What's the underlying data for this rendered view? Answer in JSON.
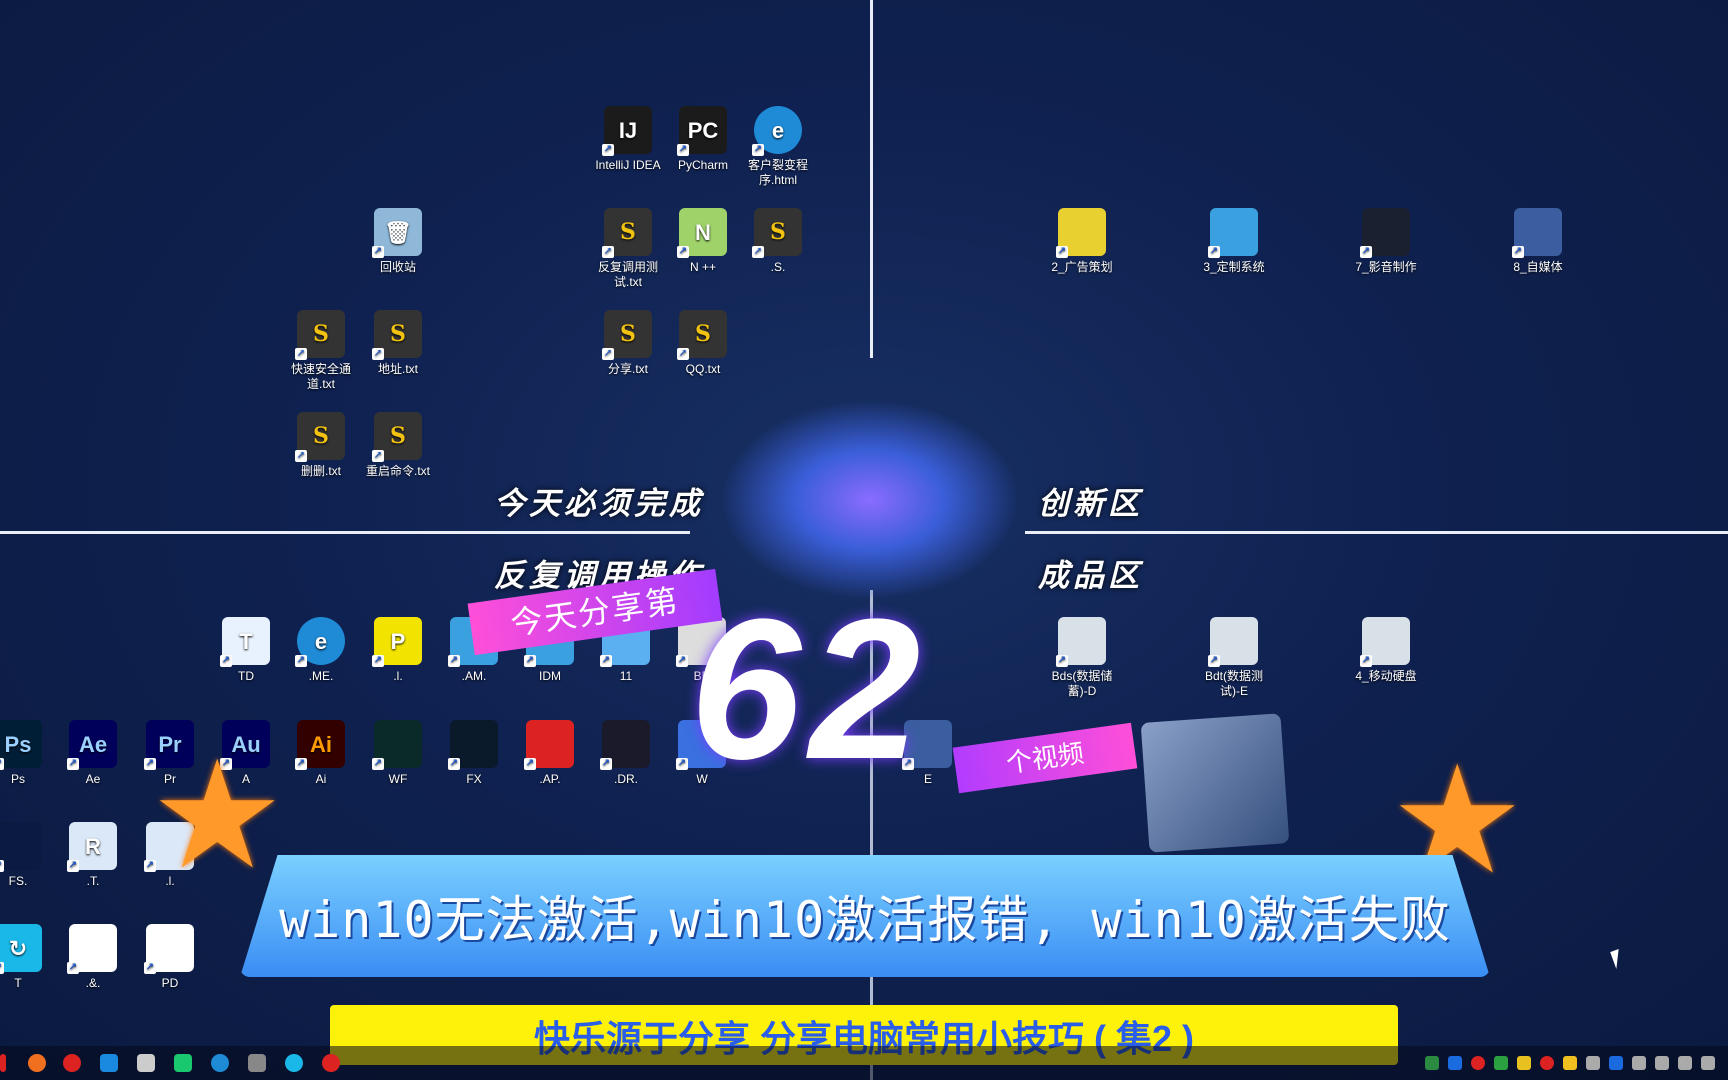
{
  "top_icons": [
    {
      "label": "IntelliJ IDEA",
      "glyph": "IJ",
      "icon": "intellij-icon",
      "color": "#1b1b1b"
    },
    {
      "label": "PyCharm",
      "glyph": "PC",
      "icon": "pycharm-icon",
      "color": "#1b1b1b"
    },
    {
      "label": "客户裂变程序.html",
      "glyph": "e",
      "icon": "edge-icon",
      "color": "#1f8ad6"
    },
    {
      "label": "回收站",
      "glyph": "🗑",
      "icon": "recycle-bin-icon",
      "color": "#8fb8d8"
    },
    {
      "label": "反复调用测试.txt",
      "glyph": "S",
      "icon": "sublime-text-icon",
      "color": "#333"
    },
    {
      "label": "N ++",
      "glyph": "N",
      "icon": "notepad-plus-icon",
      "color": "#9fd36a"
    },
    {
      "label": ".S.",
      "glyph": "S",
      "icon": "sublime-text-icon",
      "color": "#333"
    },
    {
      "label": "快速安全通道.txt",
      "glyph": "S",
      "icon": "sublime-text-icon",
      "color": "#333"
    },
    {
      "label": "地址.txt",
      "glyph": "S",
      "icon": "sublime-text-icon",
      "color": "#333"
    },
    {
      "label": "分享.txt",
      "glyph": "S",
      "icon": "sublime-text-icon",
      "color": "#333"
    },
    {
      "label": "QQ.txt",
      "glyph": "S",
      "icon": "sublime-text-icon",
      "color": "#333"
    },
    {
      "label": "删删.txt",
      "glyph": "S",
      "icon": "sublime-text-icon",
      "color": "#333"
    },
    {
      "label": "重启命令.txt",
      "glyph": "S",
      "icon": "sublime-text-icon",
      "color": "#333"
    },
    {
      "label": "2_广告策划",
      "glyph": "",
      "icon": "folder-shortcut-icon",
      "color": "#e8d030"
    },
    {
      "label": "3_定制系统",
      "glyph": "",
      "icon": "folder-shortcut-icon",
      "color": "#3aa0e0"
    },
    {
      "label": "7_影音制作",
      "glyph": "",
      "icon": "film-folder-icon",
      "color": "#1a2030"
    },
    {
      "label": "8_自媒体",
      "glyph": "",
      "icon": "film-folder-icon",
      "color": "#3a5ea0"
    }
  ],
  "bottom_icons": [
    {
      "label": "TD",
      "glyph": "T",
      "icon": "todesk-icon",
      "color": "#e8f2ff"
    },
    {
      "label": ".ME.",
      "glyph": "e",
      "icon": "edge-icon",
      "color": "#1f8ad6"
    },
    {
      "label": ".l.",
      "glyph": "P",
      "icon": "app-icon",
      "color": "#f2e400"
    },
    {
      "label": ".AM.",
      "glyph": "",
      "icon": "app-icon",
      "color": "#3aa0e0"
    },
    {
      "label": "IDM",
      "glyph": "",
      "icon": "idm-icon",
      "color": "#3aa0e0"
    },
    {
      "label": "11",
      "glyph": "",
      "icon": "app-icon",
      "color": "#5ab0f0"
    },
    {
      "label": "BD",
      "glyph": "",
      "icon": "app-icon",
      "color": "#ddd"
    },
    {
      "label": "Bds(数据储蓄)-D",
      "glyph": "",
      "icon": "drive-icon",
      "color": "#d8e0e8"
    },
    {
      "label": "Bdt(数据测试)-E",
      "glyph": "",
      "icon": "drive-icon",
      "color": "#d8e0e8"
    },
    {
      "label": "4_移动硬盘",
      "glyph": "",
      "icon": "drive-icon",
      "color": "#d8e0e8"
    },
    {
      "label": "Ps",
      "glyph": "Ps",
      "icon": "photoshop-icon",
      "color": "#001e36"
    },
    {
      "label": "Ae",
      "glyph": "Ae",
      "icon": "after-effects-icon",
      "color": "#00005b"
    },
    {
      "label": "Pr",
      "glyph": "Pr",
      "icon": "premiere-icon",
      "color": "#00005b"
    },
    {
      "label": "A",
      "glyph": "Au",
      "icon": "audition-icon",
      "color": "#00005b"
    },
    {
      "label": "Ai",
      "glyph": "Ai",
      "icon": "illustrator-icon",
      "color": "#330000"
    },
    {
      "label": "WF",
      "glyph": "",
      "icon": "filmora-icon",
      "color": "#0a2a2a"
    },
    {
      "label": "FX",
      "glyph": "",
      "icon": "filmora-icon",
      "color": "#0a1a2a"
    },
    {
      "label": ".AP.",
      "glyph": "",
      "icon": "app-icon",
      "color": "#d22"
    },
    {
      "label": ".DR.",
      "glyph": "",
      "icon": "davinci-icon",
      "color": "#1a1a2a"
    },
    {
      "label": "W",
      "glyph": "",
      "icon": "app-icon",
      "color": "#3a70e0"
    },
    {
      "label": "E",
      "glyph": "",
      "icon": "app-icon",
      "color": "#3a5ea0"
    },
    {
      "label": "FS.",
      "glyph": "",
      "icon": "audio-bars-icon",
      "color": "#0a1a40"
    },
    {
      "label": ".T.",
      "glyph": "R",
      "icon": "app-icon",
      "color": "#dbe8f8"
    },
    {
      "label": ".l.",
      "glyph": "",
      "icon": "app-icon",
      "color": "#dbe8f8"
    },
    {
      "label": "T",
      "glyph": "↻",
      "icon": "sync-icon",
      "color": "#1ab8e8"
    },
    {
      "label": ".&.",
      "glyph": "",
      "icon": "app-icon",
      "color": "#fff"
    },
    {
      "label": "PD",
      "glyph": "",
      "icon": "app-icon",
      "color": "#fff"
    }
  ],
  "zones": {
    "top_left": "今天必须完成",
    "bottom_left": "反复调用操作",
    "top_right": "创新区",
    "bottom_right": "成品区"
  },
  "promo": {
    "ribbon_top": "今天分享第",
    "number": "62",
    "ribbon_bottom": "个视频"
  },
  "banner": {
    "title": "win10无法激活,win10激活报错, win10激活失败",
    "subtitle": "快乐源于分享 分享电脑常用小技巧 ( 集2 )"
  },
  "colors": {
    "desktop": "#0e1e45",
    "banner_blue": "#3a8df4",
    "subtitle_yellow": "#fff20a",
    "subtitle_text": "#2a5ee8",
    "ribbon_pink": "#ff4fd8"
  }
}
